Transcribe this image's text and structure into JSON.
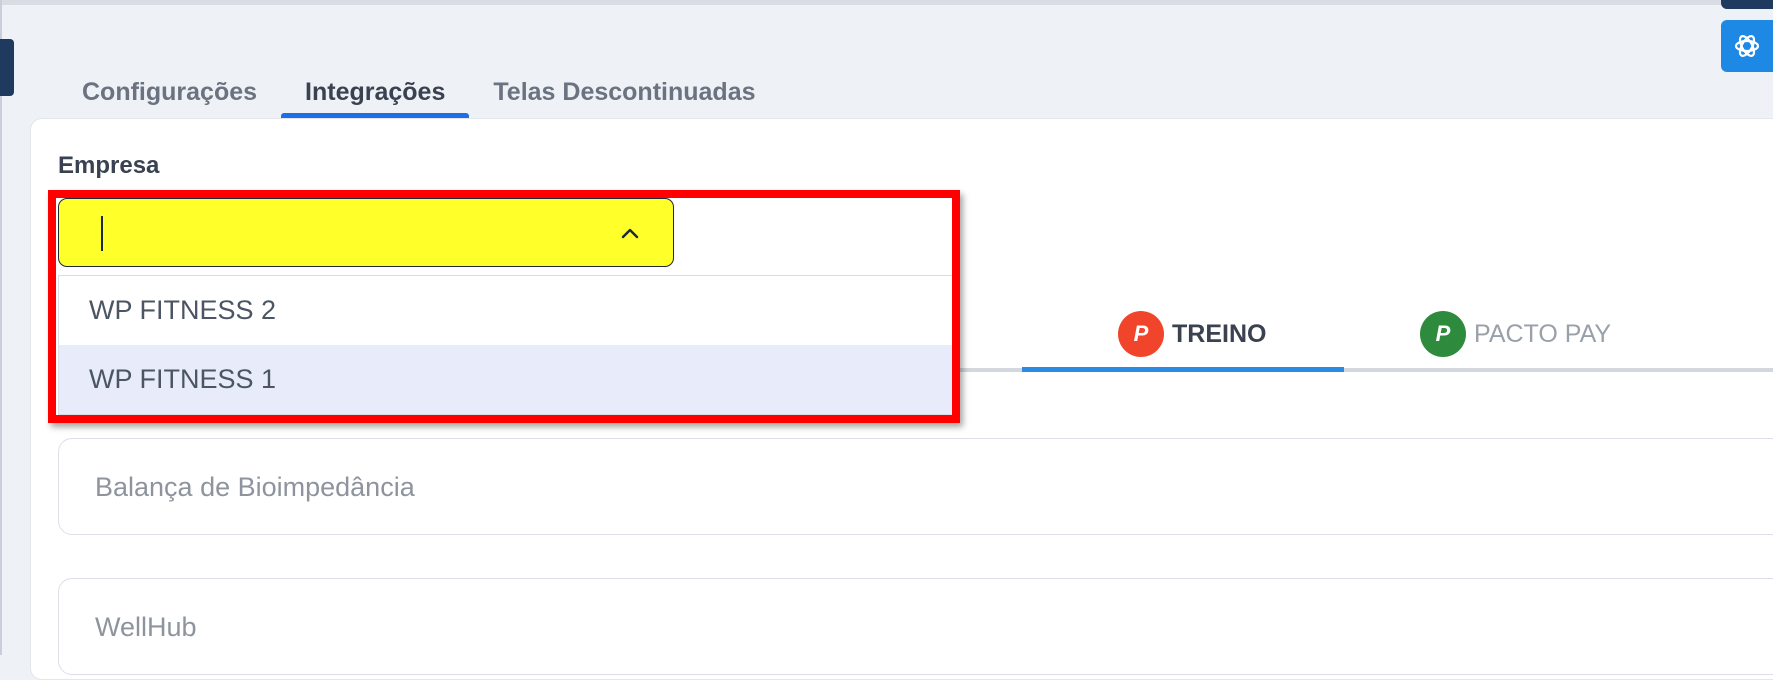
{
  "tabs": [
    {
      "label": "Configurações",
      "active": false
    },
    {
      "label": "Integrações",
      "active": true
    },
    {
      "label": "Telas Descontinuadas",
      "active": false
    }
  ],
  "empresa": {
    "label": "Empresa",
    "value": "",
    "options": [
      "WP FITNESS 2",
      "WP FITNESS 1"
    ]
  },
  "integration_tabs": [
    {
      "label": "TREINO",
      "logo_text": "P",
      "logo_color": "#f0452a",
      "active": true
    },
    {
      "label": "PACTO PAY",
      "logo_text": "P",
      "logo_color": "#2e8b3e",
      "active": false
    }
  ],
  "sections": [
    {
      "title": "Balança de Bioimpedância"
    },
    {
      "title": "WellHub"
    }
  ],
  "colors": {
    "accent": "#1e6ee6",
    "highlight_fill": "#ffff2a",
    "highlight_border": "#ff0000"
  },
  "icons": {
    "dropdown": "chevron-up-icon",
    "assistant": "openai-logo-icon"
  }
}
